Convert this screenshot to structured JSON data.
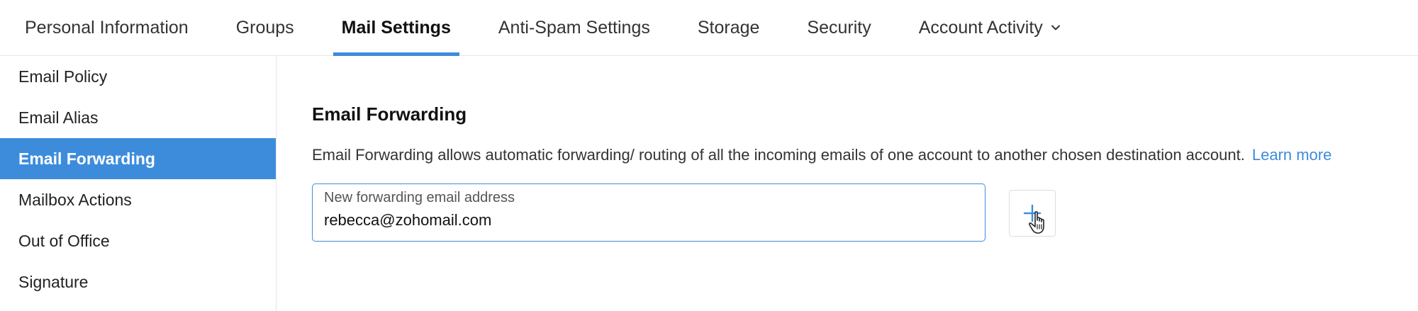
{
  "tabs": [
    {
      "label": "Personal Information",
      "active": false
    },
    {
      "label": "Groups",
      "active": false
    },
    {
      "label": "Mail Settings",
      "active": true
    },
    {
      "label": "Anti-Spam Settings",
      "active": false
    },
    {
      "label": "Storage",
      "active": false
    },
    {
      "label": "Security",
      "active": false
    },
    {
      "label": "Account Activity",
      "active": false,
      "icon": "chevron-down-icon"
    }
  ],
  "sidebar": {
    "items": [
      {
        "label": "Email Policy",
        "active": false
      },
      {
        "label": "Email Alias",
        "active": false
      },
      {
        "label": "Email Forwarding",
        "active": true
      },
      {
        "label": "Mailbox Actions",
        "active": false
      },
      {
        "label": "Out of Office",
        "active": false
      },
      {
        "label": "Signature",
        "active": false
      }
    ]
  },
  "main": {
    "title": "Email Forwarding",
    "description": "Email Forwarding allows automatic forwarding/ routing of all the incoming emails of one account to another chosen destination account.",
    "learn_more": "Learn more",
    "field": {
      "label": "New forwarding email address",
      "value": "rebecca@zohomail.com"
    },
    "add_button_icon": "plus-icon"
  },
  "colors": {
    "accent": "#3d8cdc",
    "divider": "#e6e6e6"
  }
}
